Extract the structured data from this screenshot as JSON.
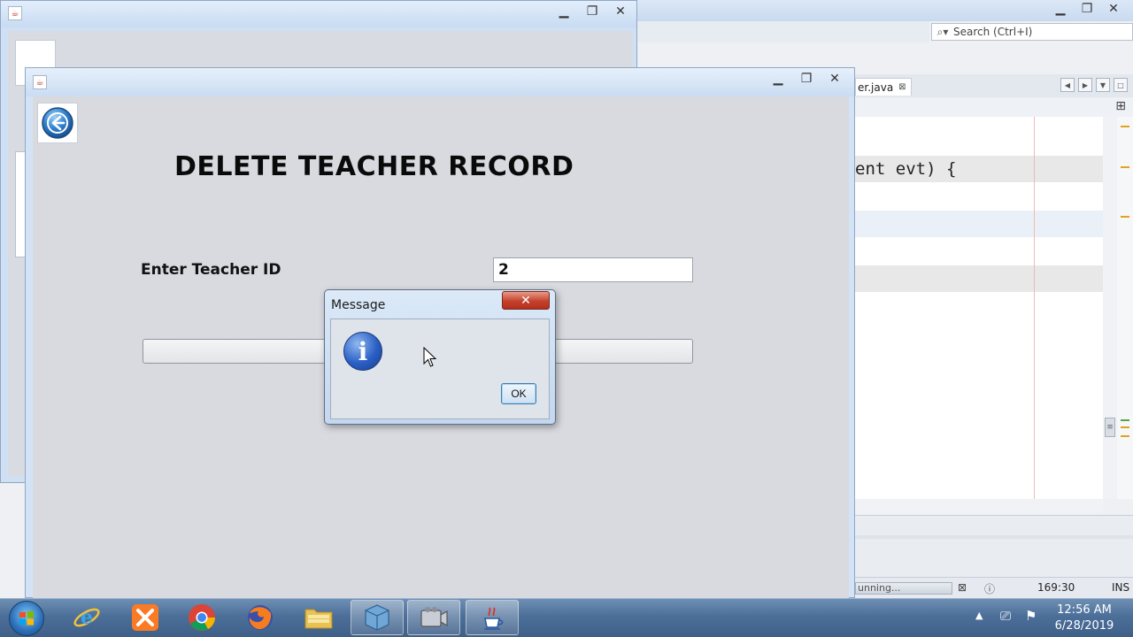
{
  "ide": {
    "search_placeholder": "Search (Ctrl+I)",
    "tab_label": "er.java",
    "code_line": "ent evt) {",
    "status_progress": "unning...",
    "status_position": "169:30",
    "status_mode": "INS"
  },
  "main_window": {
    "title": "DELETE TEACHER RECORD",
    "id_label": "Enter Teacher ID",
    "id_value": "2",
    "delete_button_label": ""
  },
  "dialog": {
    "title": "Message",
    "close_glyph": "✕",
    "ok_label": "OK"
  },
  "taskbar": {
    "time": "12:56 AM",
    "date": "6/28/2019",
    "apps": [
      "internet-explorer",
      "xampp",
      "chrome",
      "firefox",
      "file-explorer",
      "virtualbox",
      "video-recorder",
      "java"
    ]
  },
  "colors": {
    "close_red": "#c4422c",
    "info_blue": "#2a5fc4",
    "client_gray": "#d8dae0"
  }
}
